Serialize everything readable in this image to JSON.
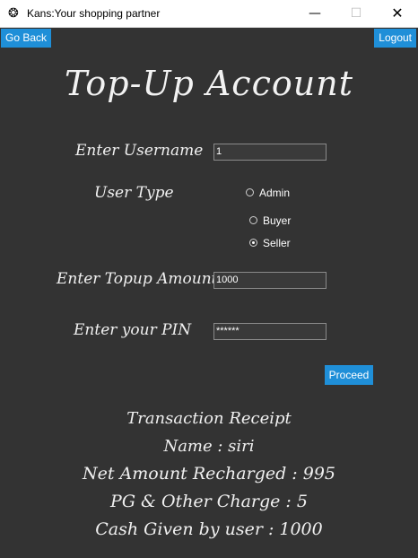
{
  "window": {
    "title": "Kans:Your shopping partner",
    "minimize": "—",
    "maximize": "☐",
    "close": "✕"
  },
  "nav": {
    "go_back": "Go Back",
    "logout": "Logout"
  },
  "heading": "Top-Up Account",
  "form": {
    "username_label": "Enter Username",
    "username_value": "1",
    "user_type_label": "User Type",
    "user_types": [
      {
        "label": "Admin",
        "selected": false
      },
      {
        "label": "Buyer",
        "selected": false
      },
      {
        "label": "Seller",
        "selected": true
      }
    ],
    "amount_label": "Enter Topup Amount",
    "amount_value": "1000",
    "pin_label": "Enter your PIN",
    "pin_value": "******",
    "proceed": "Proceed"
  },
  "receipt": {
    "title": "Transaction Receipt",
    "name": "Name : siri",
    "net_amount": "Net Amount Recharged : 995",
    "pg_charge": "PG & Other Charge : 5",
    "cash_given": "Cash Given by user : 1000"
  },
  "colors": {
    "background": "#333333",
    "accent": "#1f8fd8"
  }
}
